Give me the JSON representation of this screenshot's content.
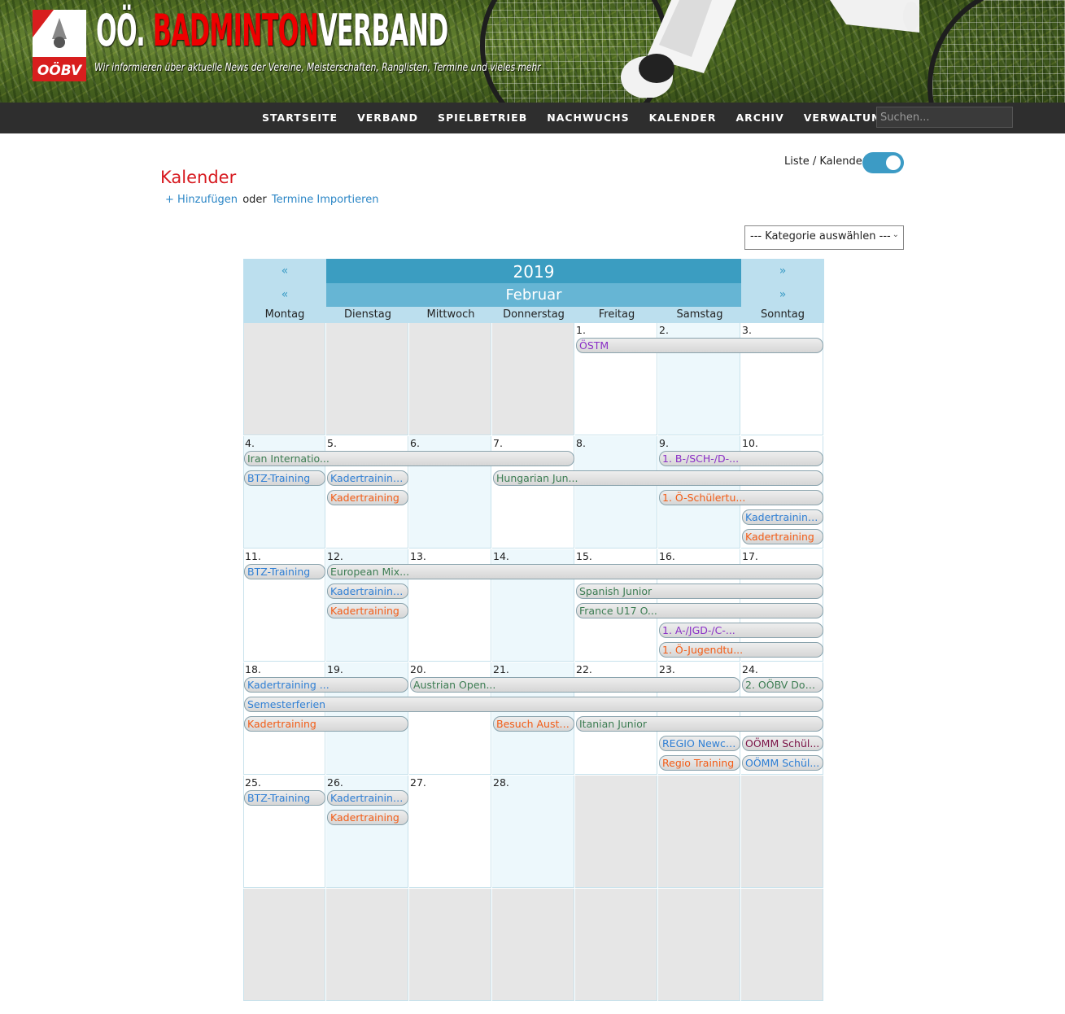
{
  "site": {
    "title_part1": "OÖ. ",
    "title_red": "BADMINTON",
    "title_part2": "VERBAND",
    "tagline": "Wir informieren über aktuelle News der Vereine, Meisterschaften, Ranglisten, Termine und vieles mehr",
    "logo_text": "OÖBV"
  },
  "nav": {
    "items": [
      "Startseite",
      "Verband",
      "Spielbetrieb",
      "Nachwuchs",
      "Kalender",
      "Archiv",
      "Verwaltung"
    ],
    "search_placeholder": "Suchen..."
  },
  "page": {
    "title": "Kalender",
    "add_label": "Hinzufügen",
    "or_label": "oder",
    "import_label": "Termine Importieren",
    "toggle_label": "Liste / Kalender",
    "category_select": "--- Kategorie auswählen ---"
  },
  "calendar": {
    "year": "2019",
    "month": "Februar",
    "prev": "«",
    "next": "»",
    "weekdays": [
      "Montag",
      "Dienstag",
      "Mittwoch",
      "Donnerstag",
      "Freitag",
      "Samstag",
      "Sonntag"
    ],
    "weeks": [
      [
        null,
        null,
        null,
        null,
        "1.",
        "2.",
        "3."
      ],
      [
        "4.",
        "5.",
        "6.",
        "7.",
        "8.",
        "9.",
        "10."
      ],
      [
        "11.",
        "12.",
        "13.",
        "14.",
        "15.",
        "16.",
        "17."
      ],
      [
        "18.",
        "19.",
        "20.",
        "21.",
        "22.",
        "23.",
        "24."
      ],
      [
        "25.",
        "26.",
        "27.",
        "28.",
        null,
        null,
        null
      ],
      [
        null,
        null,
        null,
        null,
        null,
        null,
        null
      ]
    ],
    "events": [
      {
        "week": 0,
        "start": 4,
        "span": 3,
        "row": 0,
        "label": "ÖSTM",
        "color": "purple"
      },
      {
        "week": 1,
        "start": 0,
        "span": 4,
        "row": 0,
        "label": "Iran Internatio...",
        "color": "green"
      },
      {
        "week": 1,
        "start": 5,
        "span": 2,
        "row": 0,
        "label": "1. B-/SCH-/D-...",
        "color": "purple"
      },
      {
        "week": 1,
        "start": 0,
        "span": 1,
        "row": 1,
        "label": "BTZ-Training",
        "color": "blue"
      },
      {
        "week": 1,
        "start": 1,
        "span": 1,
        "row": 1,
        "label": "Kadertraining ...",
        "color": "blue"
      },
      {
        "week": 1,
        "start": 3,
        "span": 4,
        "row": 1,
        "label": "Hungarian Jun...",
        "color": "green"
      },
      {
        "week": 1,
        "start": 1,
        "span": 1,
        "row": 2,
        "label": "Kadertraining",
        "color": "orange"
      },
      {
        "week": 1,
        "start": 5,
        "span": 2,
        "row": 2,
        "label": "1. Ö-Schülertu...",
        "color": "orange"
      },
      {
        "week": 1,
        "start": 6,
        "span": 1,
        "row": 3,
        "label": "Kadertraining ...",
        "color": "blue"
      },
      {
        "week": 1,
        "start": 6,
        "span": 1,
        "row": 4,
        "label": "Kadertraining",
        "color": "orange"
      },
      {
        "week": 2,
        "start": 0,
        "span": 1,
        "row": 0,
        "label": "BTZ-Training",
        "color": "blue"
      },
      {
        "week": 2,
        "start": 1,
        "span": 6,
        "row": 0,
        "label": "European Mix...",
        "color": "green"
      },
      {
        "week": 2,
        "start": 1,
        "span": 1,
        "row": 1,
        "label": "Kadertraining ...",
        "color": "blue"
      },
      {
        "week": 2,
        "start": 4,
        "span": 3,
        "row": 1,
        "label": "Spanish Junior",
        "color": "green"
      },
      {
        "week": 2,
        "start": 1,
        "span": 1,
        "row": 2,
        "label": "Kadertraining",
        "color": "orange"
      },
      {
        "week": 2,
        "start": 4,
        "span": 3,
        "row": 2,
        "label": "France U17 O...",
        "color": "green"
      },
      {
        "week": 2,
        "start": 5,
        "span": 2,
        "row": 3,
        "label": "1. A-/JGD-/C-...",
        "color": "purple"
      },
      {
        "week": 2,
        "start": 5,
        "span": 2,
        "row": 4,
        "label": "1. Ö-Jugendtu...",
        "color": "orange"
      },
      {
        "week": 3,
        "start": 0,
        "span": 2,
        "row": 0,
        "label": "Kadertraining ...",
        "color": "blue"
      },
      {
        "week": 3,
        "start": 2,
        "span": 4,
        "row": 0,
        "label": "Austrian Open...",
        "color": "green"
      },
      {
        "week": 3,
        "start": 6,
        "span": 1,
        "row": 0,
        "label": "2. OÖBV Dop...",
        "color": "green"
      },
      {
        "week": 3,
        "start": 0,
        "span": 7,
        "row": 1,
        "label": "Semesterferien",
        "color": "blue"
      },
      {
        "week": 3,
        "start": 0,
        "span": 2,
        "row": 2,
        "label": "Kadertraining",
        "color": "orange"
      },
      {
        "week": 3,
        "start": 3,
        "span": 1,
        "row": 2,
        "label": "Besuch Austri...",
        "color": "orange"
      },
      {
        "week": 3,
        "start": 4,
        "span": 3,
        "row": 2,
        "label": "Itanian Junior",
        "color": "green"
      },
      {
        "week": 3,
        "start": 5,
        "span": 1,
        "row": 3,
        "label": "REGIO Newco...",
        "color": "blue"
      },
      {
        "week": 3,
        "start": 6,
        "span": 1,
        "row": 3,
        "label": "OÖMM Schül...",
        "color": "maroon"
      },
      {
        "week": 3,
        "start": 5,
        "span": 1,
        "row": 4,
        "label": "Regio Training",
        "color": "orange"
      },
      {
        "week": 3,
        "start": 6,
        "span": 1,
        "row": 4,
        "label": "OÖMM Schül...",
        "color": "blue"
      },
      {
        "week": 4,
        "start": 0,
        "span": 1,
        "row": 0,
        "label": "BTZ-Training",
        "color": "blue"
      },
      {
        "week": 4,
        "start": 1,
        "span": 1,
        "row": 0,
        "label": "Kadertraining ...",
        "color": "blue"
      },
      {
        "week": 4,
        "start": 1,
        "span": 1,
        "row": 1,
        "label": "Kadertraining",
        "color": "orange"
      }
    ]
  }
}
